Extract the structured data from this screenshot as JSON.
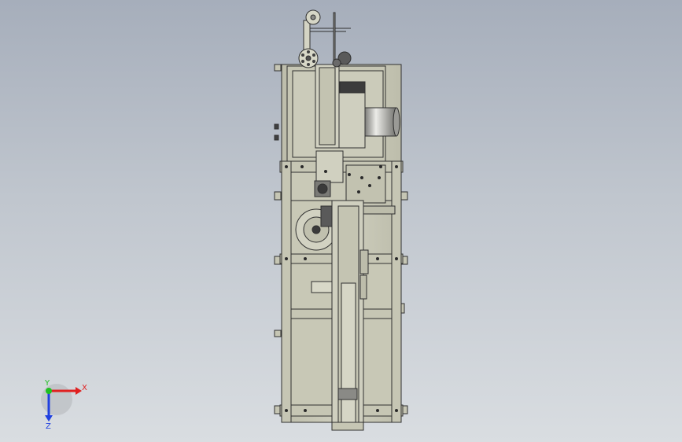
{
  "viewport": {
    "background_top": "#a6aebb",
    "background_bottom": "#d9dde1"
  },
  "model": {
    "frame_color": "#c6c6b4",
    "frame_edge_color": "#303030",
    "dark_part_color": "#3c3c3c",
    "cylinder_light": "#e8e8e4",
    "cylinder_dark": "#8a8a86"
  },
  "triad": {
    "x_label": "X",
    "y_label": "Y",
    "z_label": "Z",
    "x_color": "#e02020",
    "y_color": "#20c020",
    "z_color": "#2040e0"
  }
}
